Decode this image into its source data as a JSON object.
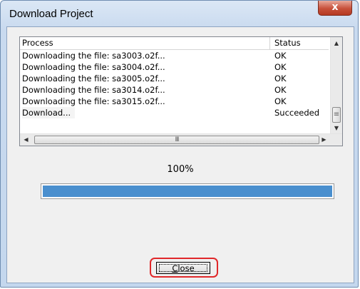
{
  "window": {
    "title": "Download Project",
    "close_glyph": "x"
  },
  "list": {
    "columns": [
      "Process",
      "Status"
    ],
    "rows": [
      {
        "process": "Downloading the file: sa3003.o2f...",
        "status": "OK"
      },
      {
        "process": "Downloading the file: sa3004.o2f...",
        "status": "OK"
      },
      {
        "process": "Downloading the file: sa3005.o2f...",
        "status": "OK"
      },
      {
        "process": "Downloading the file: sa3014.o2f...",
        "status": "OK"
      },
      {
        "process": "Downloading the file: sa3015.o2f...",
        "status": "OK"
      },
      {
        "process": "Download...",
        "status": "Succeeded"
      }
    ],
    "vscroll_up_glyph": "▲",
    "vscroll_down_glyph": "▼",
    "vscroll_thumb_glyph": "≡",
    "hscroll_left_glyph": "◀",
    "hscroll_right_glyph": "▶",
    "hscroll_thumb_glyph": "III"
  },
  "progress": {
    "percent_text": "100%",
    "value": 1.0,
    "color": "#4a8fce"
  },
  "buttons": {
    "close_label_first": "C",
    "close_label_rest": "lose",
    "highlight_color": "#e0282a"
  }
}
